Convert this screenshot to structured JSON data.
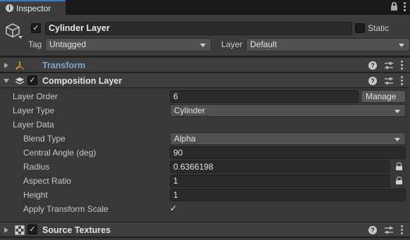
{
  "tab": {
    "label": "Inspector",
    "info_icon": "i"
  },
  "header": {
    "object_name": "Cylinder Layer",
    "static_label": "Static",
    "tag_label": "Tag",
    "tag_value": "Untagged",
    "layer_label": "Layer",
    "layer_value": "Default"
  },
  "components": {
    "transform": {
      "title": "Transform",
      "help": "?"
    },
    "composition": {
      "title": "Composition Layer",
      "help": "?"
    },
    "source_textures": {
      "title": "Source Textures",
      "help": "?"
    }
  },
  "properties": {
    "layer_order": {
      "label": "Layer Order",
      "value": "6",
      "button": "Manage"
    },
    "layer_type": {
      "label": "Layer Type",
      "value": "Cylinder"
    },
    "layer_data": {
      "label": "Layer Data"
    },
    "blend_type": {
      "label": "Blend Type",
      "value": "Alpha"
    },
    "central_angle": {
      "label": "Central Angle (deg)",
      "value": "90"
    },
    "radius": {
      "label": "Radius",
      "value": "0.6366198"
    },
    "aspect_ratio": {
      "label": "Aspect Ratio",
      "value": "1"
    },
    "height": {
      "label": "Height",
      "value": "1"
    },
    "apply_transform_scale": {
      "label": "Apply Transform Scale",
      "checked": "✓"
    }
  },
  "colors": {
    "accent": "#3a79bb",
    "link": "#7fa6d6",
    "panel": "#383838",
    "header": "#3e3e3e"
  }
}
